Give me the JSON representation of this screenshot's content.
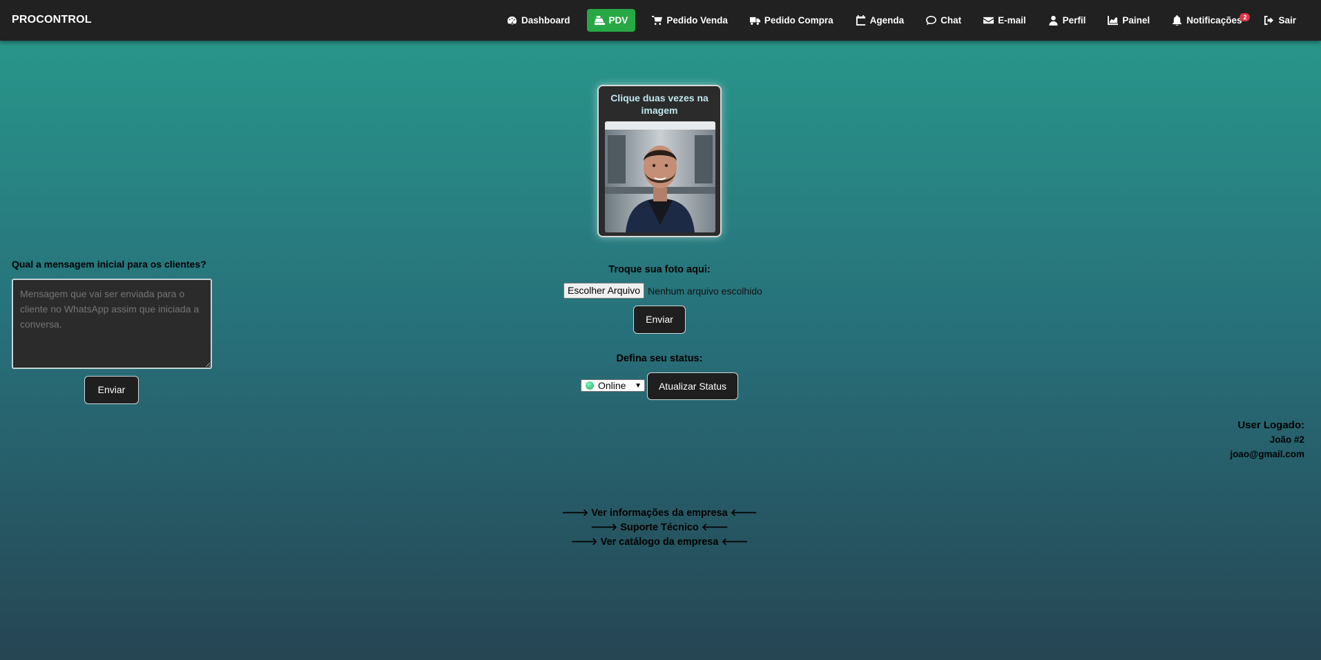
{
  "app": {
    "brand": "PROCONTROL"
  },
  "nav": {
    "items": [
      {
        "label": "Dashboard",
        "icon": "gauge-icon"
      },
      {
        "label": "PDV",
        "icon": "cash-register-icon",
        "active": true
      },
      {
        "label": "Pedido Venda",
        "icon": "cart-icon"
      },
      {
        "label": "Pedido Compra",
        "icon": "truck-icon"
      },
      {
        "label": "Agenda",
        "icon": "calendar-icon"
      },
      {
        "label": "Chat",
        "icon": "chat-bubble-icon"
      },
      {
        "label": "E-mail",
        "icon": "envelope-icon"
      },
      {
        "label": "Perfil",
        "icon": "user-icon"
      },
      {
        "label": "Painel",
        "icon": "chart-icon"
      },
      {
        "label": "Notificações",
        "icon": "bell-icon",
        "badge": "2"
      },
      {
        "label": "Sair",
        "icon": "sign-out-icon"
      }
    ],
    "active_color": "#28a745",
    "badge_color": "#dc3545"
  },
  "profile_photo": {
    "title": "Clique duas vezes na imagem",
    "change_label": "Troque sua foto aqui:",
    "file_button": "Escolher Arquivo",
    "file_status": "Nenhum arquivo escolhido",
    "submit_label": "Enviar"
  },
  "status": {
    "label": "Defina seu status:",
    "selected": "Online",
    "update_button": "Atualizar Status"
  },
  "initial_message": {
    "label": "Qual a mensagem inicial para os clientes?",
    "placeholder": "Mensagem que vai ser enviada para o cliente no WhatsApp assim que iniciada a conversa.",
    "submit_label": "Enviar"
  },
  "user": {
    "title": "User Logado:",
    "name": "João #2",
    "email": "joao@gmail.com"
  },
  "links": [
    "🡒 Ver informações da empresa 🡐",
    "🡒 Suporte Técnico 🡐",
    "🡒 Ver catálogo da empresa 🡐"
  ]
}
